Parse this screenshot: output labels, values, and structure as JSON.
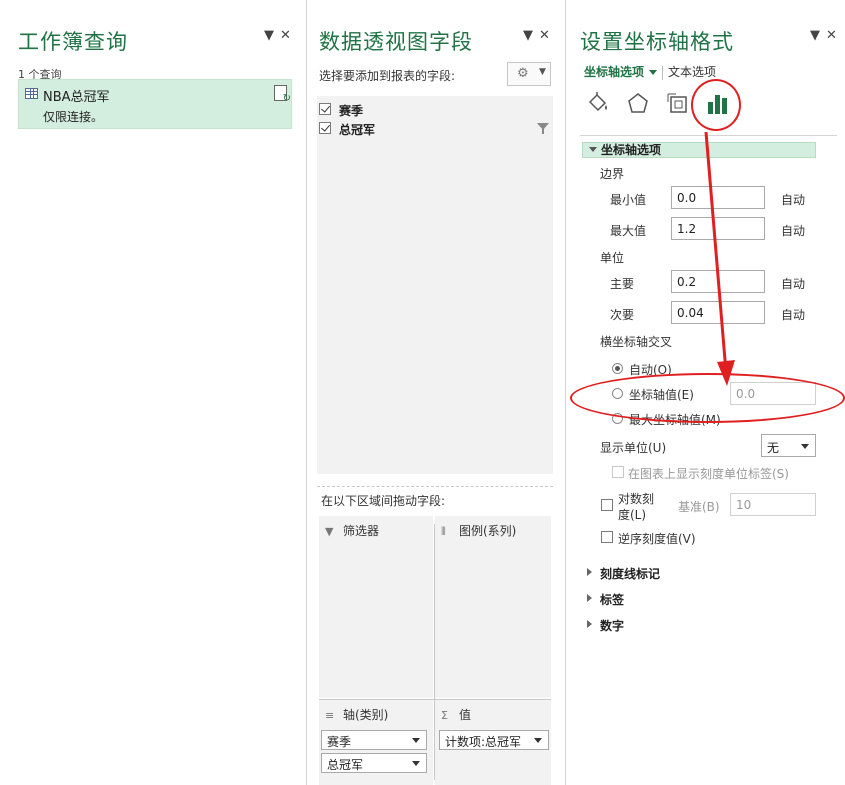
{
  "query_pane": {
    "title": "工作簿查询",
    "count": "1 个查询",
    "query": {
      "name": "NBA总冠军",
      "status": "仅限连接。"
    }
  },
  "fields_pane": {
    "title": "数据透视图字段",
    "instruction": "选择要添加到报表的字段:",
    "fields": [
      {
        "label": "赛季",
        "checked": true
      },
      {
        "label": "总冠军",
        "checked": true
      }
    ],
    "drag_label": "在以下区域间拖动字段:",
    "areas": {
      "filters": {
        "label": "筛选器"
      },
      "legend": {
        "label": "图例(系列)"
      },
      "axis": {
        "label": "轴(类别)",
        "items": [
          "赛季",
          "总冠军"
        ]
      },
      "values": {
        "label": "值",
        "items": [
          "计数项:总冠军"
        ]
      }
    }
  },
  "format_pane": {
    "title": "设置坐标轴格式",
    "tab_axis_options": "坐标轴选项",
    "tab_text_options": "文本选项",
    "section_axis_options": "坐标轴选项",
    "bounds_label": "边界",
    "min_label": "最小值",
    "min_value": "0.0",
    "max_label": "最大值",
    "max_value": "1.2",
    "units_label": "单位",
    "major_label": "主要",
    "major_value": "0.2",
    "minor_label": "次要",
    "minor_value": "0.04",
    "auto": "自动",
    "cross_label": "横坐标轴交叉",
    "radio_auto": "自动(O)",
    "radio_axis_value": "坐标轴值(E)",
    "axis_value_input": "0.0",
    "radio_max": "最大坐标轴值(M)",
    "display_units_label": "显示单位(U)",
    "display_units_value": "无",
    "show_units_label": "在图表上显示刻度单位标签(S)",
    "log_scale_line1": "对数刻",
    "log_scale_line2": "度(L)",
    "base_label": "基准(B)",
    "base_value": "10",
    "reverse_label": "逆序刻度值(V)",
    "collapsed_sections": [
      "刻度线标记",
      "标签",
      "数字"
    ]
  },
  "controls": {
    "pin": "▼",
    "close": "✕"
  },
  "colors": {
    "accent": "#217346",
    "annotation": "#e02020"
  }
}
